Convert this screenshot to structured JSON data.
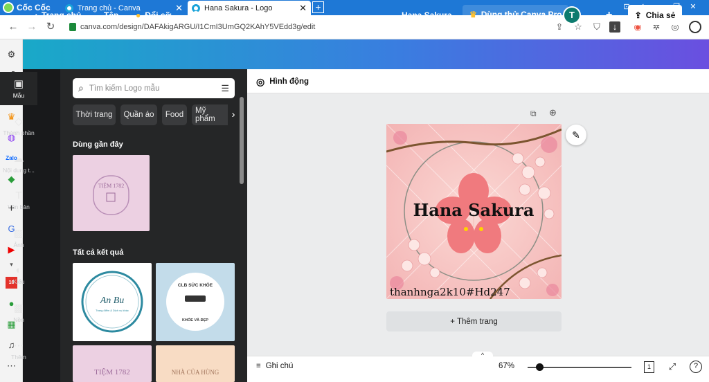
{
  "browser": {
    "brand": "Cốc Cốc",
    "tabs": [
      {
        "title": "Trang chủ - Canva"
      },
      {
        "title": "Hana Sakura - Logo"
      }
    ],
    "new_tab": "+",
    "window_buttons": [
      "⊡",
      "⇇",
      "—",
      "❐",
      "✕"
    ],
    "address": "canva.com/design/DAFAkigARGU/I1CmI3UmGQ2KAhY5VEdd3g/edit"
  },
  "canva": {
    "header": {
      "home": "Trang chủ",
      "file": "Tệp",
      "resize": "Đổi cỡ",
      "design_name": "Hana Sakura",
      "try_pro": "Dùng thử Canva Pro",
      "avatar": "T",
      "share": "Chia sẻ"
    },
    "rail": [
      {
        "label": "Mẫu",
        "icon": "template-icon"
      },
      {
        "label": "Thành phần",
        "icon": "elements-icon"
      },
      {
        "label": "Nội dung t...",
        "icon": "upload-icon"
      },
      {
        "label": "Văn bản",
        "icon": "text-icon"
      },
      {
        "label": "Ảnh",
        "icon": "photo-icon"
      },
      {
        "label": "Kiểu",
        "icon": "styles-icon"
      },
      {
        "label": "Nền",
        "icon": "background-icon"
      },
      {
        "label": "Thêm",
        "icon": "more-icon"
      }
    ],
    "panel": {
      "search_placeholder": "Tìm kiếm Logo mẫu",
      "chips": [
        "Thời trang",
        "Quần áo",
        "Food",
        "Mỹ phẩm"
      ],
      "recent_heading": "Dùng gần đây",
      "recent_thumb_text": "TIỆM 1782",
      "all_heading": "Tất cả kết quả",
      "results": [
        {
          "title": "An Bu",
          "subtitle": "Trang điểm & Dịch vụ khác"
        },
        {
          "title": "CLB SỨC KHỎE",
          "subtitle": "KHỎE VÀ ĐẸP"
        },
        {
          "title": "TIỆM 1782",
          "subtitle": ""
        },
        {
          "title": "NHÀ CỦA HÙNG",
          "subtitle": ""
        }
      ]
    },
    "toolbar": {
      "animate": "Hình động"
    },
    "design": {
      "title": "Hana Sakura",
      "watermark": "thanhnga2k10#Hd247"
    },
    "add_page": "+ Thêm trang",
    "footer": {
      "notes": "Ghi chú",
      "zoom": "67%",
      "page_number": "1"
    }
  },
  "colors": {
    "header_start": "#19a9c8",
    "header_end": "#6a4fe0",
    "panel_bg": "#252627",
    "design_bg": "#f7c9c4",
    "petal": "#f07a7e"
  }
}
